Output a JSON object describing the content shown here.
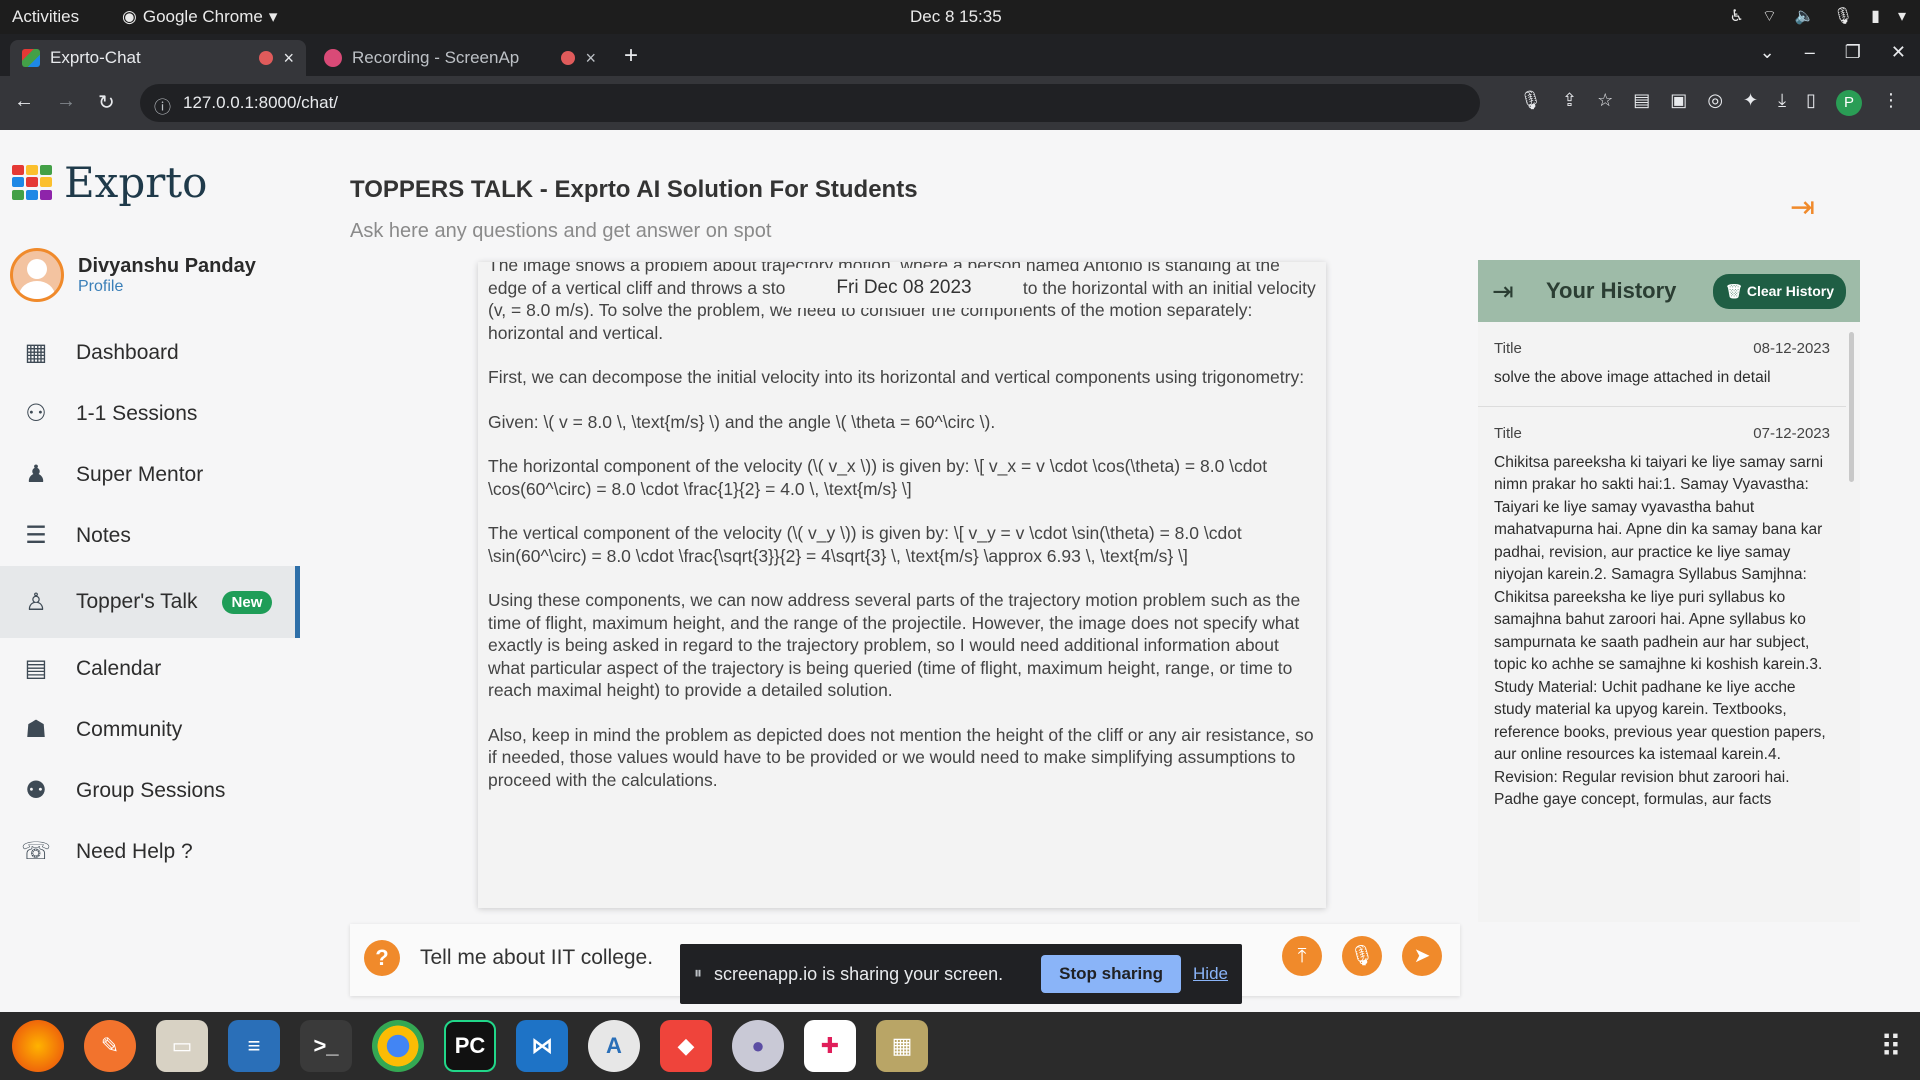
{
  "system": {
    "activities": "Activities",
    "app_name": "Google Chrome",
    "clock": "Dec 8  15:35"
  },
  "browser": {
    "tabs": [
      {
        "label": "Exprto-Chat"
      },
      {
        "label": "Recording - ScreenAp"
      }
    ],
    "url": "127.0.0.1:8000/chat/",
    "profile_initial": "P"
  },
  "sidebar": {
    "logo_text": "Exprto",
    "user_name": "Divyanshu Panday",
    "user_sub": "Profile",
    "items": [
      {
        "label": "Dashboard",
        "icon": "dashboard-icon"
      },
      {
        "label": "1-1 Sessions",
        "icon": "sessions-icon"
      },
      {
        "label": "Super Mentor",
        "icon": "mentor-icon"
      },
      {
        "label": "Notes",
        "icon": "notes-icon"
      },
      {
        "label": "Topper's Talk",
        "icon": "topper-icon",
        "badge": "New"
      },
      {
        "label": "Calendar",
        "icon": "calendar-icon"
      },
      {
        "label": "Community",
        "icon": "community-icon"
      },
      {
        "label": "Group Sessions",
        "icon": "group-icon"
      },
      {
        "label": "Need Help ?",
        "icon": "help-icon"
      }
    ]
  },
  "main": {
    "title": "TOPPERS TALK - Exprto AI Solution For Students",
    "subtitle": "Ask here any questions and get answer on spot",
    "date_chip": "Fri Dec 08 2023",
    "answer_paragraphs": [
      "The image shows a problem about trajectory motion, where a person named Antonio is standing at the edge of a vertical cliff and throws a stone upwards at an angle of 60° to the horizontal with an initial velocity (v, = 8.0 m/s). To solve the problem, we need to consider the components of the motion separately: horizontal and vertical.",
      "First, we can decompose the initial velocity into its horizontal and vertical components using trigonometry:",
      "Given: \\( v = 8.0 \\, \\text{m/s} \\) and the angle \\( \\theta = 60^\\circ \\).",
      "The horizontal component of the velocity (\\( v_x \\)) is given by: \\[ v_x = v \\cdot \\cos(\\theta) = 8.0 \\cdot \\cos(60^\\circ) = 8.0 \\cdot \\frac{1}{2} = 4.0 \\, \\text{m/s} \\]",
      "The vertical component of the velocity (\\( v_y \\)) is given by: \\[ v_y = v \\cdot \\sin(\\theta) = 8.0 \\cdot \\sin(60^\\circ) = 8.0 \\cdot \\frac{\\sqrt{3}}{2} = 4\\sqrt{3} \\, \\text{m/s} \\approx 6.93 \\, \\text{m/s} \\]",
      "Using these components, we can now address several parts of the trajectory motion problem such as the time of flight, maximum height, and the range of the projectile. However, the image does not specify what exactly is being asked in regard to the trajectory problem, so I would need additional information about what particular aspect of the trajectory is being queried (time of flight, maximum height, range, or time to reach maximal height) to provide a detailed solution.",
      "Also, keep in mind the problem as depicted does not mention the height of the cliff or any air resistance, so if needed, those values would have to be provided or we would need to make simplifying assumptions to proceed with the calculations."
    ],
    "input_text": "Tell me about IIT college."
  },
  "history": {
    "title": "Your History",
    "clear_label": "Clear History",
    "items": [
      {
        "title_label": "Title",
        "date": "08-12-2023",
        "text": "solve the above image attached in detail"
      },
      {
        "title_label": "Title",
        "date": "07-12-2023",
        "text": "Chikitsa pareeksha ki taiyari ke liye samay sarni nimn prakar ho sakti hai:1. Samay Vyavastha: Taiyari ke liye samay vyavastha bahut mahatvapurna hai. Apne din ka samay bana kar padhai, revision, aur practice ke liye samay niyojan karein.2. Samagra Syllabus Samjhna: Chikitsa pareeksha ke liye puri syllabus ko samajhna bahut zaroori hai. Apne syllabus ko sampurnata ke saath padhein aur har subject, topic ko achhe se samajhne ki koshish karein.3. Study Material: Uchit padhane ke liye acche study material ka upyog karein. Textbooks, reference books, previous year question papers, aur online resources ka istemaal karein.4. Revision: Regular revision bhut zaroori hai. Padhe gaye concept, formulas, aur facts"
      }
    ]
  },
  "share_bar": {
    "message": "screenapp.io is sharing your screen.",
    "stop_label": "Stop sharing",
    "hide_label": "Hide"
  },
  "colors": {
    "accent_orange": "#f08a2b",
    "history_header": "#9ebba8",
    "clear_button": "#1f5e44",
    "badge_green": "#1f9d58",
    "active_bar": "#2e6fa8"
  }
}
